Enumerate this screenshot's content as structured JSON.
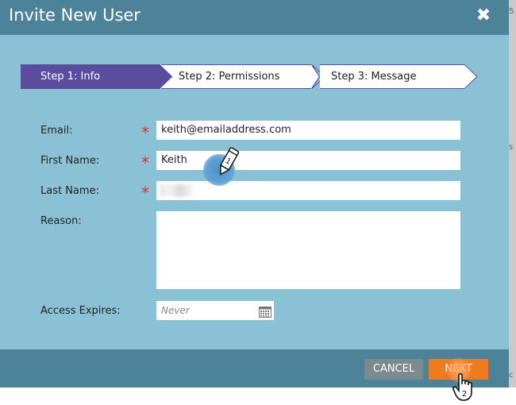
{
  "dialog": {
    "title": "Invite New User",
    "close_glyph": "✖"
  },
  "steps": [
    {
      "label": "Step 1: Info",
      "active": true
    },
    {
      "label": "Step 2: Permissions",
      "active": false
    },
    {
      "label": "Step 3: Message",
      "active": false
    }
  ],
  "form": {
    "email": {
      "label": "Email:",
      "value": "keith@emailaddress.com",
      "required": true
    },
    "first_name": {
      "label": "First Name:",
      "value": "Keith",
      "required": true
    },
    "last_name": {
      "label": "Last Name:",
      "value": "",
      "required": true
    },
    "reason": {
      "label": "Reason:",
      "value": ""
    },
    "access_expires": {
      "label": "Access Expires:",
      "placeholder": "Never"
    },
    "required_marker": "*"
  },
  "footer": {
    "cancel_label": "CANCEL",
    "next_label": "NEXT"
  },
  "annotations": {
    "pencil_step": "1",
    "hand_step": "2"
  },
  "colors": {
    "titlebar": "#4d8399",
    "body": "#8bc1d4",
    "active_step": "#5b4d9e",
    "next_button": "#ef7a1f",
    "cancel_button": "#7b8a90",
    "required": "#d2343b"
  },
  "icons": {
    "close": "close-icon",
    "calendar": "calendar-icon",
    "pencil": "pencil-cursor-icon",
    "hand": "hand-cursor-icon"
  }
}
